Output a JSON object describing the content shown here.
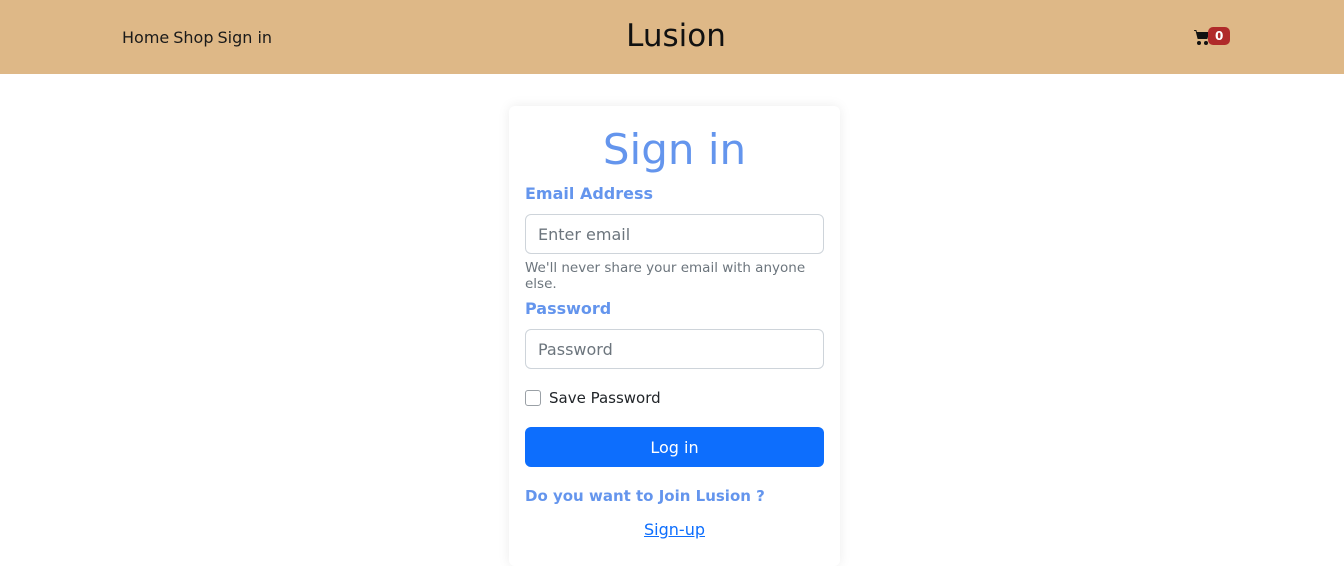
{
  "nav": {
    "links": [
      "Home",
      "Shop",
      "Sign in"
    ],
    "brand": "Lusion",
    "cart_icon": "cart-icon",
    "cart_count": "0",
    "bg_color": "#deb887"
  },
  "form": {
    "title": "Sign in",
    "email_label": "Email Address",
    "email_placeholder": "Enter email",
    "email_value": "",
    "email_help": "We'll never share your email with anyone else.",
    "password_label": "Password",
    "password_placeholder": "Password",
    "password_value": "",
    "save_password_label": "Save Password",
    "save_password_checked": false,
    "login_label": "Log in",
    "join_prompt": "Do you want to Join Lusion ?",
    "signup_link": "Sign-up",
    "accent_color": "#6495ed",
    "button_color": "#0d6efd"
  }
}
